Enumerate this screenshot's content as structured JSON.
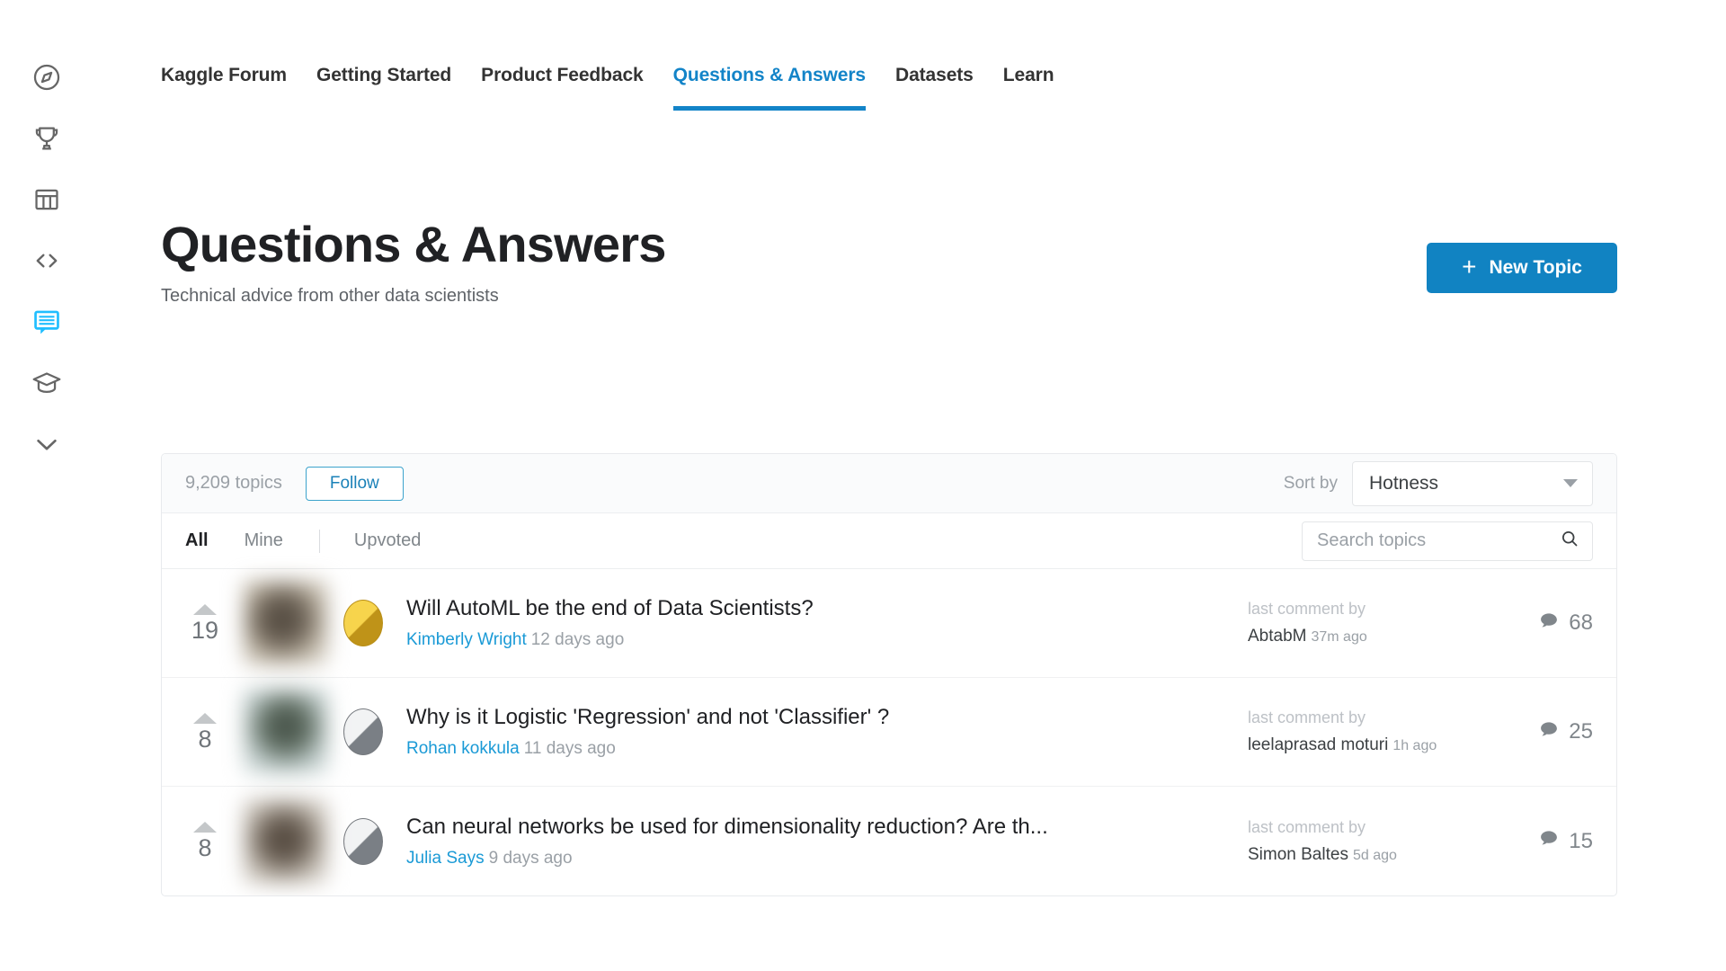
{
  "sidebar": {
    "items": [
      {
        "name": "compass-icon",
        "label": "Home",
        "active": false
      },
      {
        "name": "trophy-icon",
        "label": "Competitions",
        "active": false
      },
      {
        "name": "table-icon",
        "label": "Datasets",
        "active": false
      },
      {
        "name": "code-icon",
        "label": "Code",
        "active": false
      },
      {
        "name": "discussion-icon",
        "label": "Discussions",
        "active": true
      },
      {
        "name": "graduation-cap-icon",
        "label": "Courses",
        "active": false
      },
      {
        "name": "chevron-down-icon",
        "label": "More",
        "active": false
      }
    ]
  },
  "nav": {
    "tabs": [
      {
        "label": "Kaggle Forum",
        "active": false
      },
      {
        "label": "Getting Started",
        "active": false
      },
      {
        "label": "Product Feedback",
        "active": false
      },
      {
        "label": "Questions & Answers",
        "active": true
      },
      {
        "label": "Datasets",
        "active": false
      },
      {
        "label": "Learn",
        "active": false
      }
    ]
  },
  "header": {
    "title": "Questions & Answers",
    "subtitle": "Technical advice from other data scientists",
    "new_topic_label": "New Topic",
    "plus_glyph": "+"
  },
  "card": {
    "topic_count": "9,209 topics",
    "follow_label": "Follow",
    "sort_label": "Sort by",
    "sort_value": "Hotness",
    "filters": [
      {
        "label": "All",
        "active": true
      },
      {
        "label": "Mine",
        "active": false
      },
      {
        "label": "Upvoted",
        "active": false
      }
    ],
    "search_placeholder": "Search topics",
    "search_value": ""
  },
  "topics": [
    {
      "votes": "19",
      "tier": "gold",
      "title": "Will AutoML be the end of Data Scientists?",
      "author": "Kimberly Wright",
      "time": "12 days ago",
      "last_comment_label": "last comment by",
      "last_comment_user": "AbtabM",
      "last_comment_time": "37m ago",
      "comments": "68"
    },
    {
      "votes": "8",
      "tier": "silver",
      "title": "Why is it Logistic 'Regression' and not 'Classifier' ?",
      "author": "Rohan kokkula",
      "time": "11 days ago",
      "last_comment_label": "last comment by",
      "last_comment_user": "leelaprasad moturi",
      "last_comment_time": "1h ago",
      "comments": "25"
    },
    {
      "votes": "8",
      "tier": "silver",
      "title": "Can neural networks be used for dimensionality reduction? Are th...",
      "author": "Julia Says",
      "time": "9 days ago",
      "last_comment_label": "last comment by",
      "last_comment_user": "Simon Baltes",
      "last_comment_time": "5d ago",
      "comments": "15"
    }
  ],
  "colors": {
    "accent": "#20beff",
    "link": "#1a9ad6",
    "button": "#1183c2",
    "tab_active": "#1384c8",
    "gold": "#f7d44c",
    "silver": "#f2f3f4"
  }
}
